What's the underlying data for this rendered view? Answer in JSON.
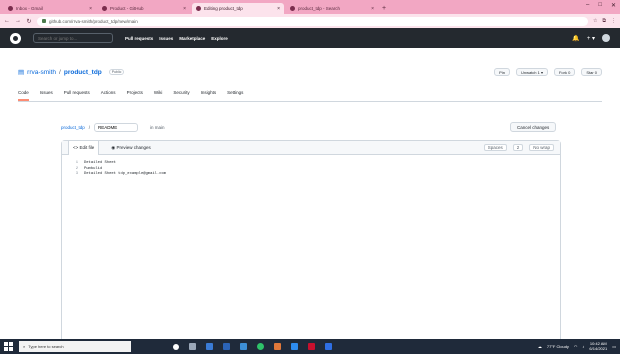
{
  "browser": {
    "tabs": [
      {
        "label": "Inbox - Gmail",
        "active": false
      },
      {
        "label": "Product - GitHub",
        "active": false
      },
      {
        "label": "Editing product_tdp",
        "active": true
      },
      {
        "label": "product_tdp - Search",
        "active": false
      }
    ],
    "new_tab": "+",
    "window_controls": [
      "–",
      "□",
      "✕"
    ],
    "url": "github.com/rrva-smith/product_tdp/new/main",
    "extensions": [
      "☆",
      "⧉",
      "⋮"
    ]
  },
  "github": {
    "search_placeholder": "Search or jump to...",
    "nav": [
      "Pull requests",
      "Issues",
      "Marketplace",
      "Explore"
    ],
    "right_icons": [
      "🔔",
      "+ ▾"
    ]
  },
  "repo": {
    "owner": "rrva-smith",
    "name": "product_tdp",
    "visibility": "Public",
    "actions": [
      "Pin",
      "Unwatch 1 ▾",
      "Fork 0",
      "Star 0"
    ],
    "tabs": [
      "Code",
      "Issues",
      "Pull requests",
      "Actions",
      "Projects",
      "Wiki",
      "Security",
      "Insights",
      "Settings"
    ]
  },
  "editor": {
    "repo_link": "product_tdp",
    "filename_value": "README",
    "filename_placeholder": "Name your file...",
    "in_branch": "in main",
    "cancel_label": "Cancel changes",
    "tab_edit": "Edit file",
    "tab_preview": "Preview changes",
    "opt_indent": "Spaces",
    "opt_size": "2",
    "opt_wrap": "No wrap",
    "lines": [
      "Detailed Sheet",
      "Pumbulid",
      "Detailed Sheet tdp_example@gmail.com"
    ]
  },
  "taskbar": {
    "search_placeholder": "Type here to search",
    "tray_temp": "77°F Cloudy",
    "time": "10:42 AM",
    "date": "6/14/2021"
  },
  "colors": {
    "tabstrip": "#f2a7c3",
    "gh_header": "#24292f",
    "link": "#0969da",
    "taskbar": "#1f2a3a"
  }
}
